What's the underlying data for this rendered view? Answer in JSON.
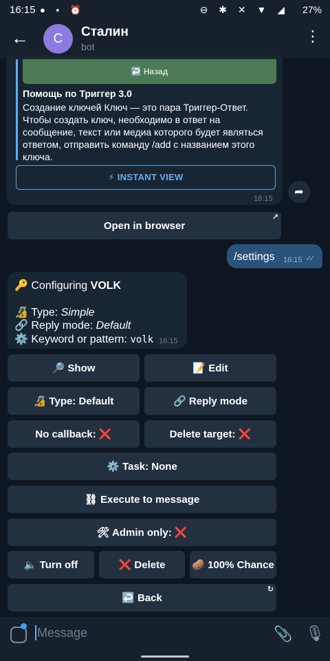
{
  "status_bar": {
    "time": "16:15",
    "battery": "27%"
  },
  "header": {
    "avatar_letter": "С",
    "title": "Сталин",
    "subtitle": "bot"
  },
  "preview": {
    "image_button": "↩️ Назад",
    "title": "Помощь по Триггер 3.0",
    "text": "Создание ключей Ключ — это пара Триггер-Ответ. Чтобы создать ключ, необходимо в ответ на сообщение, текст или медиа которого будет являться ответом, отправить команду /add с названием этого ключа.",
    "instant_view": "⚡ INSTANT VIEW",
    "time": "16:15"
  },
  "open_browser": "Open in browser",
  "outgoing": {
    "text": "/settings",
    "time": "16:15"
  },
  "config": {
    "line1_prefix": "🔑 Configuring ",
    "line1_name": "VOLK",
    "type_label": "🔏 Type: ",
    "type_value": "Simple",
    "reply_label": "🔗 Reply mode: ",
    "reply_value": "Default",
    "keyword_label": "⚙️ Keyword or pattern: ",
    "keyword_value": "volk",
    "time": "16:15"
  },
  "keyboard": {
    "show": "🔎 Show",
    "edit": "📝 Edit",
    "type_default": "🔏 Type: Default",
    "reply_mode": "🔗 Reply mode",
    "no_callback": "No callback: ❌",
    "delete_target": "Delete target: ❌",
    "task": "⚙️ Task: None",
    "execute": "⛓ Execute to message",
    "admin_only": "🛠 Admin only: ❌",
    "turn_off": "🔈 Turn off",
    "delete": "❌ Delete",
    "chance": "🥔 100% Chance",
    "back": "↩️ Back"
  },
  "input": {
    "placeholder": "Message"
  },
  "colors": {
    "background": "#0e1621",
    "bubble_in": "#182533",
    "bubble_out": "#2b5278",
    "button": "#22303f",
    "accent": "#62aeef"
  }
}
